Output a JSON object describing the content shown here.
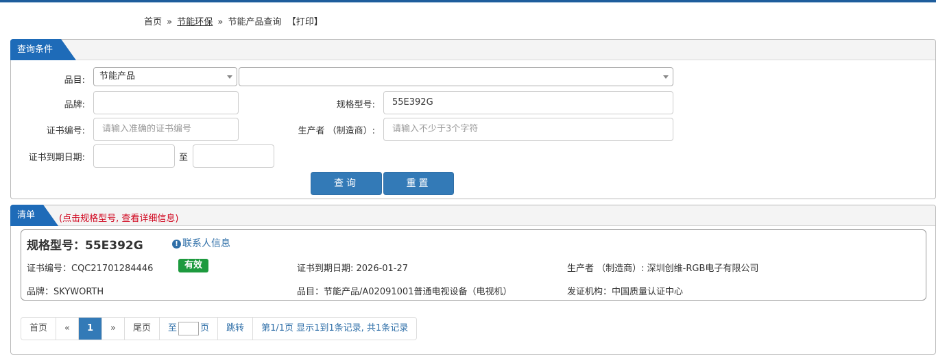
{
  "breadcrumb": {
    "home": "首页",
    "sep1": "»",
    "category": "节能环保",
    "sep2": "»",
    "current": "节能产品查询",
    "print": "【打印】"
  },
  "query_panel": {
    "title": "查询条件",
    "category_label": "品目:",
    "category_value": "节能产品",
    "subcategory_value": "",
    "brand_label": "品牌:",
    "brand_value": "",
    "model_label": "规格型号:",
    "model_value": "55E392G",
    "cert_no_label": "证书编号:",
    "cert_no_placeholder": "请输入准确的证书编号",
    "manufacturer_label": "生产者 （制造商）:",
    "manufacturer_placeholder": "请输入不少于3个字符",
    "expiry_label": "证书到期日期:",
    "expiry_to": "至",
    "expiry_from_value": "",
    "expiry_to_value": "",
    "query_button": "查询",
    "reset_button": "重置"
  },
  "list_panel": {
    "title": "清单",
    "note": "(点击规格型号, 查看详细信息)",
    "records": [
      {
        "title": "规格型号：55E392G",
        "contact": "联系人信息",
        "cert_no": "证书编号：CQC21701284446",
        "status": "有效",
        "expiry": "证书到期日期: 2026-01-27",
        "manufacturer": "生产者 （制造商）: 深圳创维-RGB电子有限公司",
        "brand": "品牌：SKYWORTH",
        "category": "品目：节能产品/A02091001普通电视设备（电视机）",
        "issuer": "发证机构：中国质量认证中心"
      }
    ]
  },
  "pagination": {
    "first": "首页",
    "prev": "«",
    "current_page": "1",
    "next": "»",
    "last": "尾页",
    "goto_prefix": "至",
    "goto_suffix": "页",
    "jump": "跳转",
    "summary": "第1/1页  显示1到1条记录, 共1条记录"
  },
  "colors": {
    "accent": "#337ab7",
    "tab": "#1e6bb8",
    "valid_badge": "#1d9a3e",
    "note_red": "#d0021b"
  }
}
